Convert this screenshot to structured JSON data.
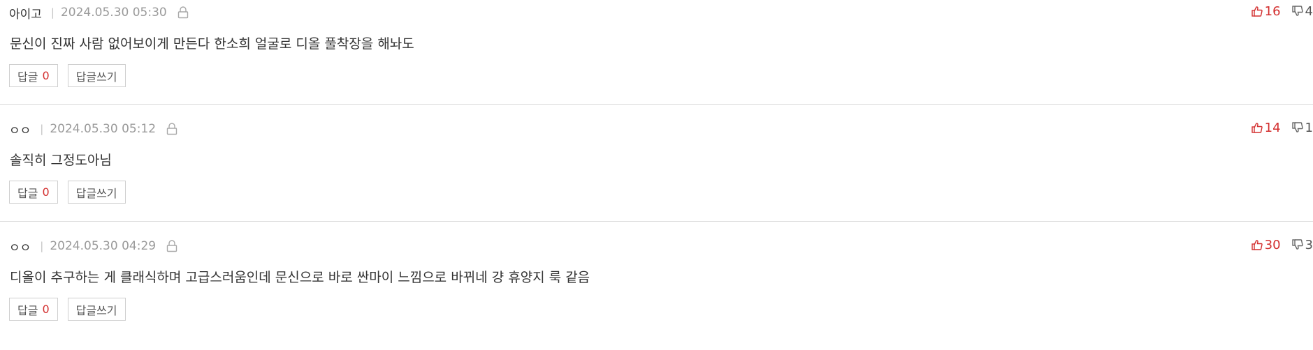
{
  "reply_label": "답글",
  "write_reply_label": "답글쓰기",
  "comments": [
    {
      "author": "아이고",
      "separator": "|",
      "date": "2024.05.30 05:30",
      "text": "문신이 진짜 사람 없어보이게 만든다 한소희 얼굴로 디올 풀착장을 해놔도",
      "reply_count": "0",
      "likes": "16",
      "dislikes": "4"
    },
    {
      "author": "ㅇㅇ",
      "separator": "|",
      "date": "2024.05.30 05:12",
      "text": "솔직히 그정도아님",
      "reply_count": "0",
      "likes": "14",
      "dislikes": "1"
    },
    {
      "author": "ㅇㅇ",
      "separator": "|",
      "date": "2024.05.30 04:29",
      "text": "디올이 추구하는 게 클래식하며 고급스러움인데 문신으로 바로 싼마이 느낌으로 바뀌네 걍 휴양지 룩 같음",
      "reply_count": "0",
      "likes": "30",
      "dislikes": "3"
    }
  ],
  "colors": {
    "like": "#d32f2f",
    "reply_count": "#d32f2f",
    "muted": "#9a9a9a",
    "border": "#cfcfcf"
  },
  "icons": {
    "lock": "lock-icon",
    "thumbs_up": "thumbs-up-icon",
    "thumbs_down": "thumbs-down-icon"
  }
}
